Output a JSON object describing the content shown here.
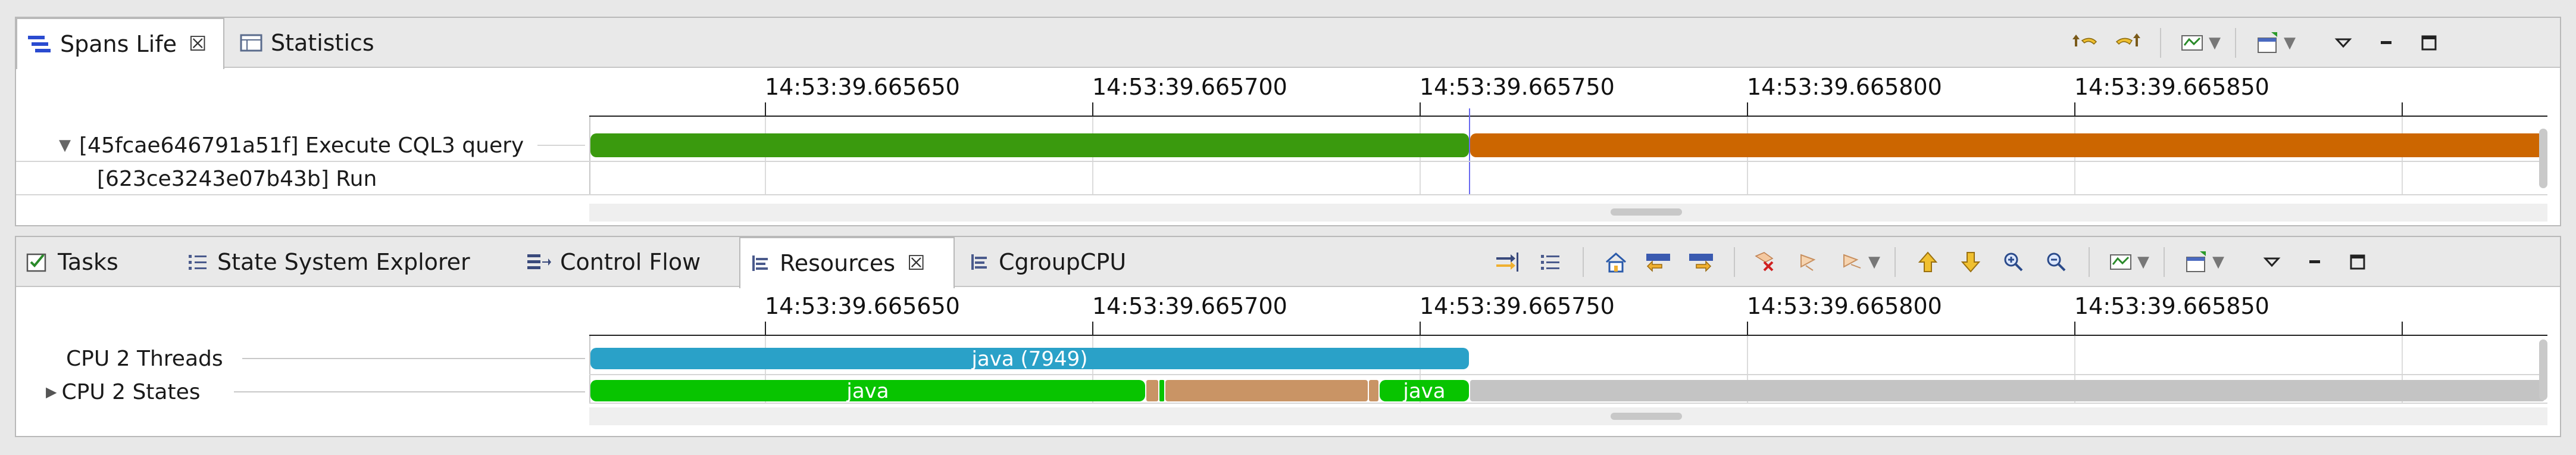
{
  "top_view": {
    "tabs": [
      {
        "label": "Spans Life",
        "icon": "spans-life-icon",
        "active": true,
        "closable": true
      },
      {
        "label": "Statistics",
        "icon": "statistics-icon",
        "active": false,
        "closable": false
      }
    ],
    "close_glyph": "☒",
    "time_labels": [
      "14:53:39.665650",
      "14:53:39.665700",
      "14:53:39.665750",
      "14:53:39.665800",
      "14:53:39.665850"
    ],
    "rows": [
      {
        "label": "[45fcae646791a51f] Execute CQL3 query",
        "expanded": true
      },
      {
        "label": "[623ce3243e07b43b] Run",
        "expanded": false
      }
    ],
    "colors": {
      "span_green": "#3a9a0e",
      "span_orange": "#cc6600"
    }
  },
  "bottom_view": {
    "tabs": [
      {
        "label": "Tasks",
        "icon": "tasks-icon"
      },
      {
        "label": "State System Explorer",
        "icon": "state-system-explorer-icon"
      },
      {
        "label": "Control Flow",
        "icon": "control-flow-icon"
      },
      {
        "label": "Resources",
        "icon": "resources-icon",
        "active": true,
        "closable": true
      },
      {
        "label": "CgroupCPU",
        "icon": "cgroupcpu-icon"
      }
    ],
    "close_glyph": "☒",
    "time_labels": [
      "14:53:39.665650",
      "14:53:39.665700",
      "14:53:39.665750",
      "14:53:39.665800",
      "14:53:39.665850"
    ],
    "rows": [
      {
        "label": "CPU 2 Threads",
        "expanded": false
      },
      {
        "label": "CPU 2 States",
        "expanded": false
      }
    ],
    "bar_labels": {
      "threads": "java (7949)",
      "states_a": "java",
      "states_b": "java"
    },
    "colors": {
      "threads_blue": "#2aa1c8",
      "states_green": "#08c400",
      "states_tan": "#c99465",
      "idle_gray": "#c4c4c4"
    }
  },
  "glyphs": {
    "expanded": "▼",
    "collapsed": "▶",
    "dropdown": "▼"
  }
}
